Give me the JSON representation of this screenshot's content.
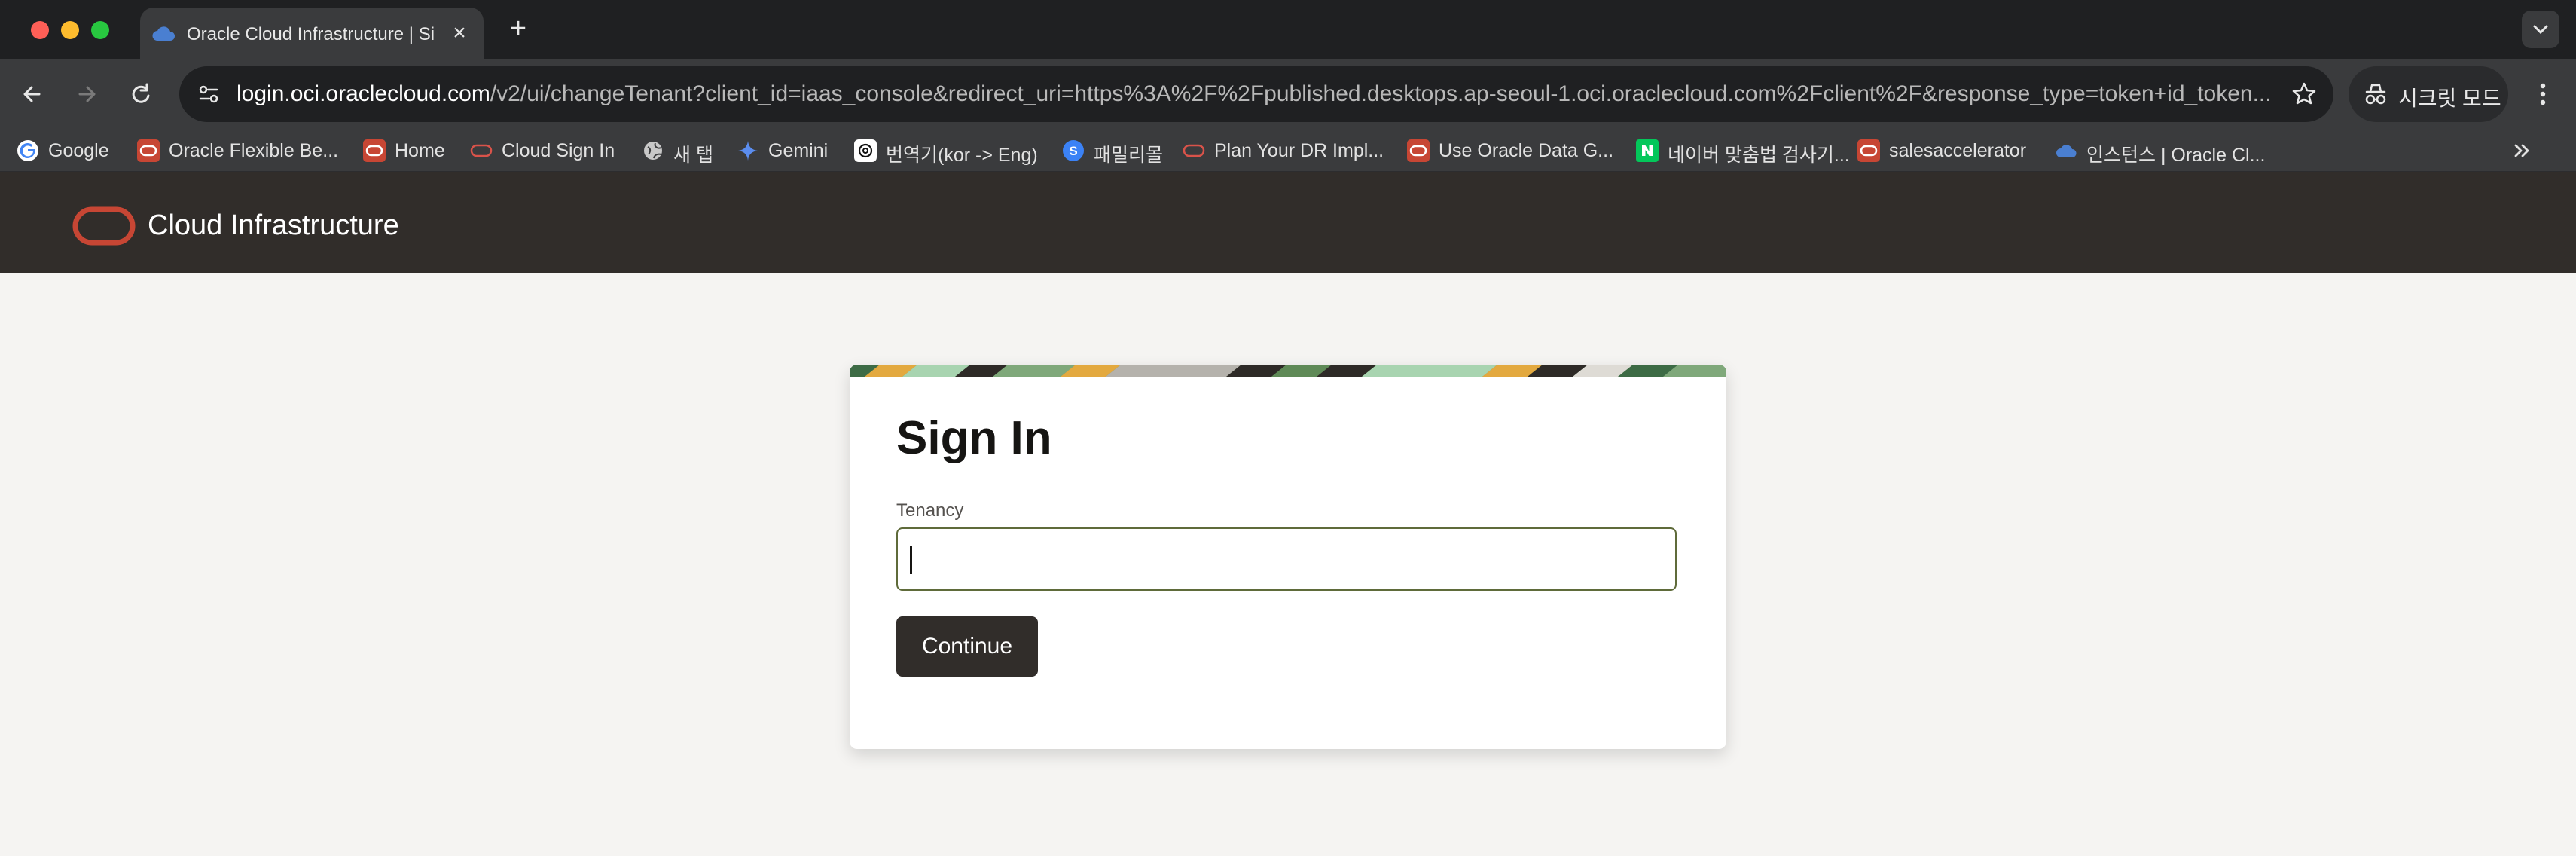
{
  "browser": {
    "tab": {
      "title": "Oracle Cloud Infrastructure | Sign In",
      "favicon": "cloud-icon"
    },
    "url": {
      "host": "login.oci.oraclecloud.com",
      "path": "/v2/ui/changeTenant?client_id=iaas_console&redirect_uri=https%3A%2F%2Fpublished.desktops.ap-seoul-1.oci.oraclecloud.com%2Fclient%2F&response_type=token+id_token..."
    },
    "incognito_label": "시크릿 모드",
    "bookmarks": [
      {
        "label": "Google",
        "icon": "google-icon"
      },
      {
        "label": "Oracle Flexible Be...",
        "icon": "oracle-icon"
      },
      {
        "label": "Home",
        "icon": "oracle-icon"
      },
      {
        "label": "Cloud Sign In",
        "icon": "oracle-outline-icon"
      },
      {
        "label": "새 탭",
        "icon": "globe-icon"
      },
      {
        "label": "Gemini",
        "icon": "gemini-icon"
      },
      {
        "label": "번역기(kor -> Eng)",
        "icon": "chatgpt-icon"
      },
      {
        "label": "패밀리몰",
        "icon": "s-circle-icon"
      },
      {
        "label": "Plan Your DR Impl...",
        "icon": "oracle-outline-icon"
      },
      {
        "label": "Use Oracle Data G...",
        "icon": "oracle-icon"
      },
      {
        "label": "네이버 맞춤법 검사기...",
        "icon": "naver-icon"
      },
      {
        "label": "salesaccelerator",
        "icon": "oracle-icon"
      },
      {
        "label": "인스턴스 | Oracle Cl...",
        "icon": "cloud-icon"
      }
    ]
  },
  "header": {
    "brand": "Cloud Infrastructure"
  },
  "signin": {
    "title": "Sign In",
    "tenancy_label": "Tenancy",
    "tenancy_value": "",
    "continue_label": "Continue"
  },
  "colors": {
    "header_bg": "#312d2a",
    "oracle_red": "#c74634",
    "button_bg": "#312d2a",
    "input_border": "#5f6b3a",
    "page_bg": "#f5f4f2"
  }
}
